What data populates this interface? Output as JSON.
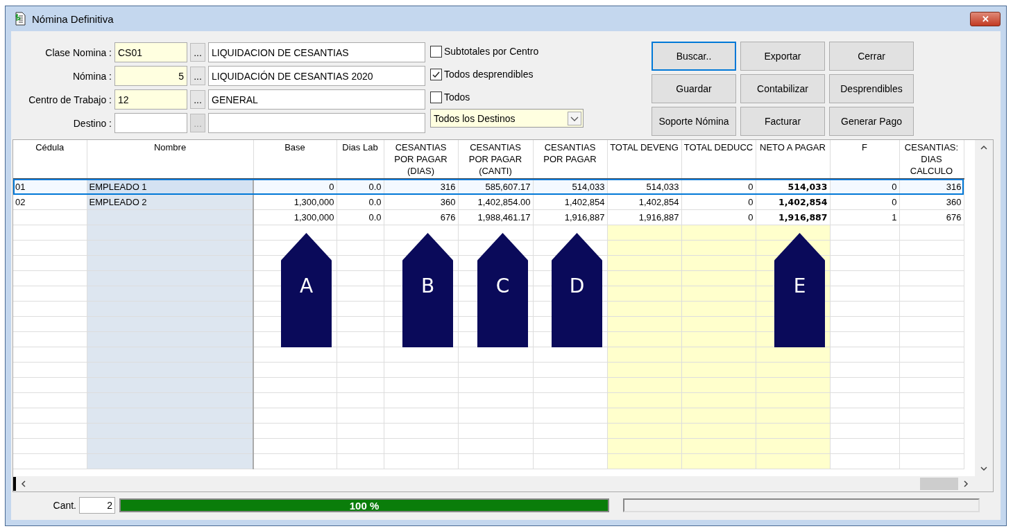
{
  "window": {
    "title": "Nómina Definitiva",
    "close_label": "✕"
  },
  "form": {
    "fields": [
      {
        "label": "Clase Nomina :",
        "code": "CS01",
        "kind": "text",
        "lookup": "...",
        "lookup_disabled": false,
        "description": "LIQUIDACION DE CESANTIAS"
      },
      {
        "label": "Nómina :",
        "code": "5",
        "kind": "number",
        "lookup": "...",
        "lookup_disabled": false,
        "description": "LIQUIDACIÓN DE CESANTIAS 2020"
      },
      {
        "label": "Centro de Trabajo :",
        "code": "12",
        "kind": "text",
        "lookup": "...",
        "lookup_disabled": false,
        "description": "GENERAL"
      },
      {
        "label": "Destino :",
        "kind": "text",
        "lookup": "...",
        "lookup_disabled": true
      }
    ],
    "checkboxes": [
      {
        "label": "Subtotales por Centro",
        "checked": false
      },
      {
        "label": "Todos desprendibles",
        "checked": true
      },
      {
        "label": "Todos",
        "checked": false
      }
    ],
    "dropdown": {
      "value": "Todos los Destinos"
    }
  },
  "buttons": [
    {
      "label": "Buscar..",
      "focused": true
    },
    {
      "label": "Exportar",
      "focused": false
    },
    {
      "label": "Cerrar",
      "focused": false
    },
    {
      "label": "Guardar",
      "focused": false
    },
    {
      "label": "Contabilizar",
      "focused": false
    },
    {
      "label": "Desprendibles",
      "focused": false
    },
    {
      "label": "Soporte Nómina",
      "focused": false
    },
    {
      "label": "Facturar",
      "focused": false
    },
    {
      "label": "Generar Pago",
      "focused": false
    }
  ],
  "table": {
    "columns": [
      {
        "header": "Cédula",
        "kind": "id"
      },
      {
        "header": "Nombre",
        "kind": "name"
      },
      {
        "header": "Base",
        "kind": "number"
      },
      {
        "header": "Dias Lab",
        "kind": "number"
      },
      {
        "header": "CESANTIAS POR PAGAR (DIAS)",
        "kind": "number"
      },
      {
        "header": "CESANTIAS POR PAGAR (CANTI)",
        "kind": "number"
      },
      {
        "header": "CESANTIAS POR PAGAR",
        "kind": "number"
      },
      {
        "header": "TOTAL DEVENG",
        "kind": "total"
      },
      {
        "header": "TOTAL DEDUCC",
        "kind": "total"
      },
      {
        "header": "NETO A PAGAR",
        "kind": "net"
      },
      {
        "header": "F",
        "kind": "number"
      },
      {
        "header": "CESANTIAS: DIAS CALCULO",
        "kind": "number"
      }
    ],
    "rows": [
      {
        "selected": true,
        "cells": [
          "01",
          "EMPLEADO 1",
          "0",
          "0.0",
          "316",
          "585,607.17",
          "514,033",
          "514,033",
          "0",
          "514,033",
          "0",
          "316"
        ]
      },
      {
        "selected": false,
        "cells": [
          "02",
          "EMPLEADO 2",
          "1,300,000",
          "0.0",
          "360",
          "1,402,854.00",
          "1,402,854",
          "1,402,854",
          "0",
          "1,402,854",
          "0",
          "360"
        ]
      },
      {
        "selected": false,
        "cells": [
          "",
          "",
          "1,300,000",
          "0.0",
          "676",
          "1,988,461.17",
          "1,916,887",
          "1,916,887",
          "0",
          "1,916,887",
          "1",
          "676"
        ]
      }
    ]
  },
  "callouts": [
    {
      "letter": "A"
    },
    {
      "letter": "B"
    },
    {
      "letter": "C"
    },
    {
      "letter": "D"
    },
    {
      "letter": "E"
    }
  ],
  "status_bar": {
    "count_label": "Cant.",
    "count": "2",
    "progress": {
      "level": 1,
      "text": "100 %"
    },
    "secondary_progress": {
      "level": 0
    }
  }
}
